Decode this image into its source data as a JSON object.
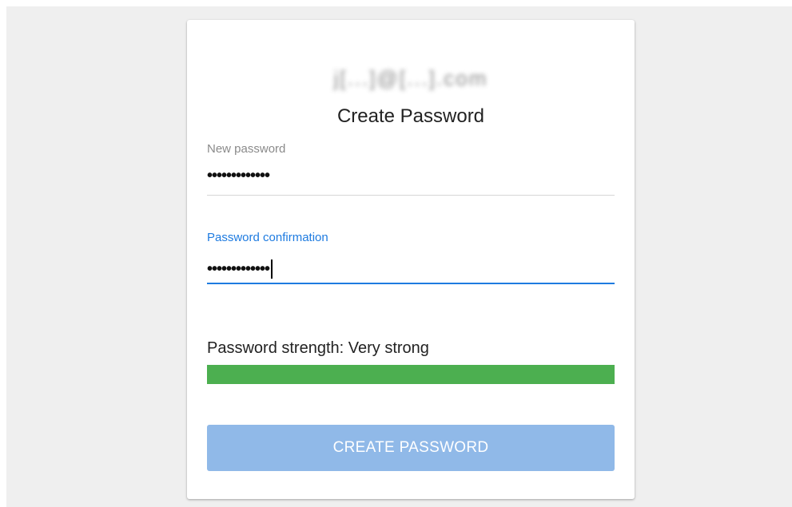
{
  "account": {
    "email_blurred": "j[...]@[...].com"
  },
  "form": {
    "title": "Create Password",
    "new_password": {
      "label": "New password",
      "masked_value": "•••••••••••••"
    },
    "confirmation": {
      "label": "Password confirmation",
      "masked_value": "•••••••••••••",
      "focused": true
    },
    "strength": {
      "text": "Password strength: Very strong",
      "level_fraction": 1.0,
      "color": "#4caf50"
    },
    "submit_label": "CREATE PASSWORD"
  },
  "colors": {
    "accent": "#1e7be0",
    "button_disabled": "#90b9e8",
    "background": "#efefef"
  }
}
